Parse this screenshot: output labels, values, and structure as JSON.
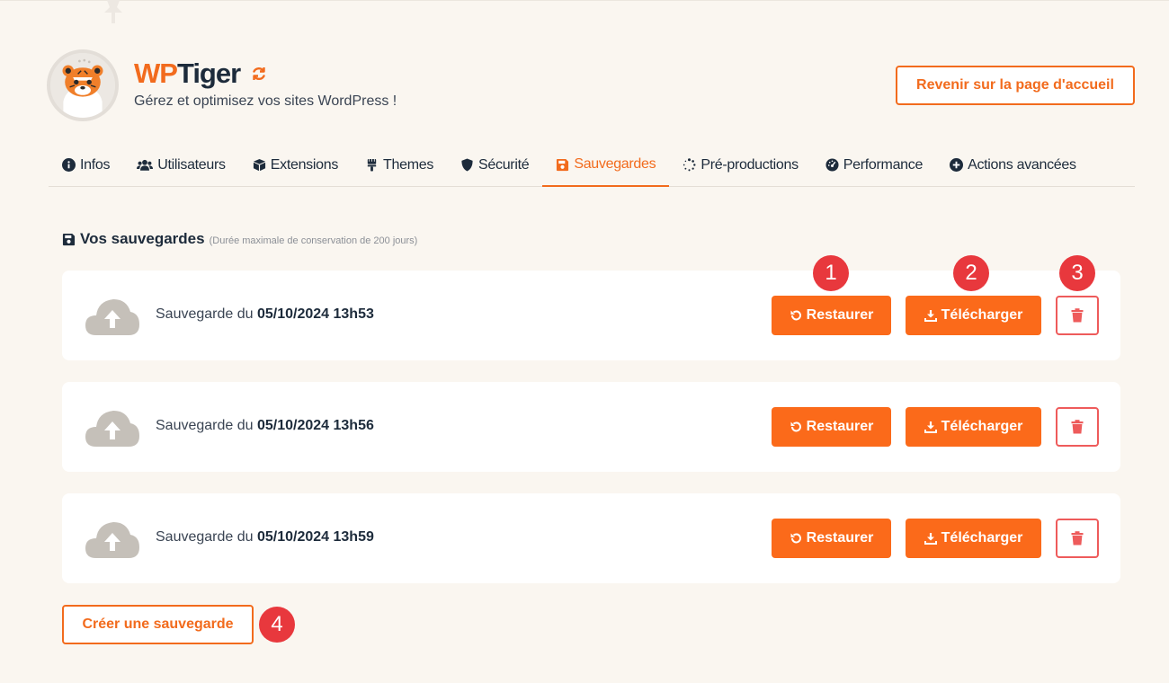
{
  "header": {
    "brand_wp": "WP",
    "brand_tiger": "Tiger",
    "tagline": "Gérez et optimisez vos sites WordPress !",
    "home_button": "Revenir sur la page d'accueil",
    "logo_icon": "tiger-mascot-icon",
    "sync_icon": "sync-icon"
  },
  "tabs": [
    {
      "label": "Infos",
      "icon": "info-icon",
      "active": false
    },
    {
      "label": "Utilisateurs",
      "icon": "users-icon",
      "active": false
    },
    {
      "label": "Extensions",
      "icon": "cube-icon",
      "active": false
    },
    {
      "label": "Themes",
      "icon": "paintbrush-icon",
      "active": false
    },
    {
      "label": "Sécurité",
      "icon": "shield-icon",
      "active": false
    },
    {
      "label": "Sauvegardes",
      "icon": "floppy-disk-icon",
      "active": true
    },
    {
      "label": "Pré-productions",
      "icon": "spinner-icon",
      "active": false
    },
    {
      "label": "Performance",
      "icon": "gauge-icon",
      "active": false
    },
    {
      "label": "Actions avancées",
      "icon": "plus-circle-icon",
      "active": false
    }
  ],
  "section": {
    "title": "Vos sauvegardes",
    "subtitle": "(Durée maximale de conservation de 200 jours)"
  },
  "backups": [
    {
      "prefix": "Sauvegarde du ",
      "date": "05/10/2024 13h53"
    },
    {
      "prefix": "Sauvegarde du ",
      "date": "05/10/2024 13h56"
    },
    {
      "prefix": "Sauvegarde du ",
      "date": "05/10/2024 13h59"
    }
  ],
  "actions": {
    "restore_label": "Restaurer",
    "download_label": "Télécharger"
  },
  "badges": [
    "1",
    "2",
    "3",
    "4"
  ],
  "create_button": "Créer une sauvegarde",
  "colors": {
    "accent": "#f26b1d",
    "button_fill": "#fb6a1a",
    "danger": "#ee5b5b",
    "badge": "#e8383d",
    "background": "#faf6f0"
  }
}
